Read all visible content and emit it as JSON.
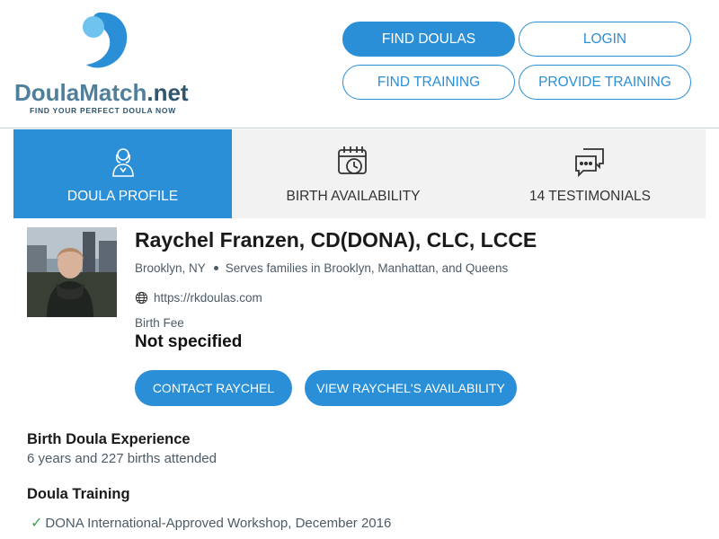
{
  "logo": {
    "name_part1": "Doula",
    "name_part2": "Match",
    "name_part3": ".net",
    "tagline": "FIND YOUR PERFECT DOULA NOW"
  },
  "nav": {
    "find_doulas": "FIND DOULAS",
    "login": "LOGIN",
    "find_training": "FIND TRAINING",
    "provide_training": "PROVIDE TRAINING"
  },
  "tabs": [
    {
      "label": "DOULA PROFILE",
      "icon": "doula-person-icon",
      "active": true
    },
    {
      "label": "BIRTH AVAILABILITY",
      "icon": "calendar-clock-icon",
      "active": false
    },
    {
      "label": "14 TESTIMONIALS",
      "icon": "chat-bubbles-icon",
      "active": false
    }
  ],
  "profile": {
    "name": "Raychel Franzen, CD(DONA), CLC, LCCE",
    "city": "Brooklyn, NY",
    "serves": "Serves families in Brooklyn, Manhattan, and Queens",
    "website": "https://rkdoulas.com",
    "fee_label": "Birth Fee",
    "fee_value": "Not specified",
    "contact_button": "CONTACT RAYCHEL",
    "availability_button": "VIEW RAYCHEL'S AVAILABILITY"
  },
  "experience": {
    "heading": "Birth Doula Experience",
    "text": "6 years and 227 births attended"
  },
  "training": {
    "heading": "Doula Training",
    "items": [
      "DONA International-Approved Workshop, December 2016"
    ]
  },
  "colors": {
    "accent": "#2a8fd6",
    "tab_bg": "#f2f2f2",
    "check": "#3aa64a"
  }
}
